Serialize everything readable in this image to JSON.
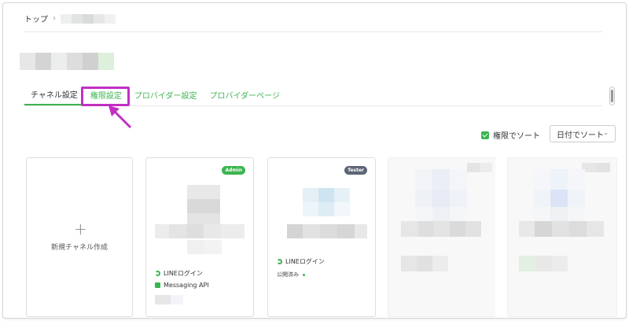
{
  "breadcrumb": {
    "home": "トップ",
    "separator": "›"
  },
  "tabs": [
    {
      "label": "チャネル設定",
      "active": true
    },
    {
      "label": "権限設定",
      "active": false
    },
    {
      "label": "プロバイダー設定",
      "active": false
    },
    {
      "label": "プロバイダーページ",
      "active": false
    }
  ],
  "sort": {
    "checkbox_label": "権限でソート",
    "checked": true,
    "select_value": "日付でソート",
    "caret": "⌄"
  },
  "new_channel": {
    "plus": "+",
    "label": "新規チャネル作成"
  },
  "cards": [
    {
      "badge": "Admin",
      "services": [
        "LINEログイン",
        "Messaging API"
      ]
    },
    {
      "badge": "Tester",
      "services": [
        "LINEログイン"
      ],
      "status": "公開済み"
    }
  ],
  "colors": {
    "accent": "#3cb44f",
    "highlight": "#c22fc4",
    "tester_badge": "#5b6675"
  }
}
